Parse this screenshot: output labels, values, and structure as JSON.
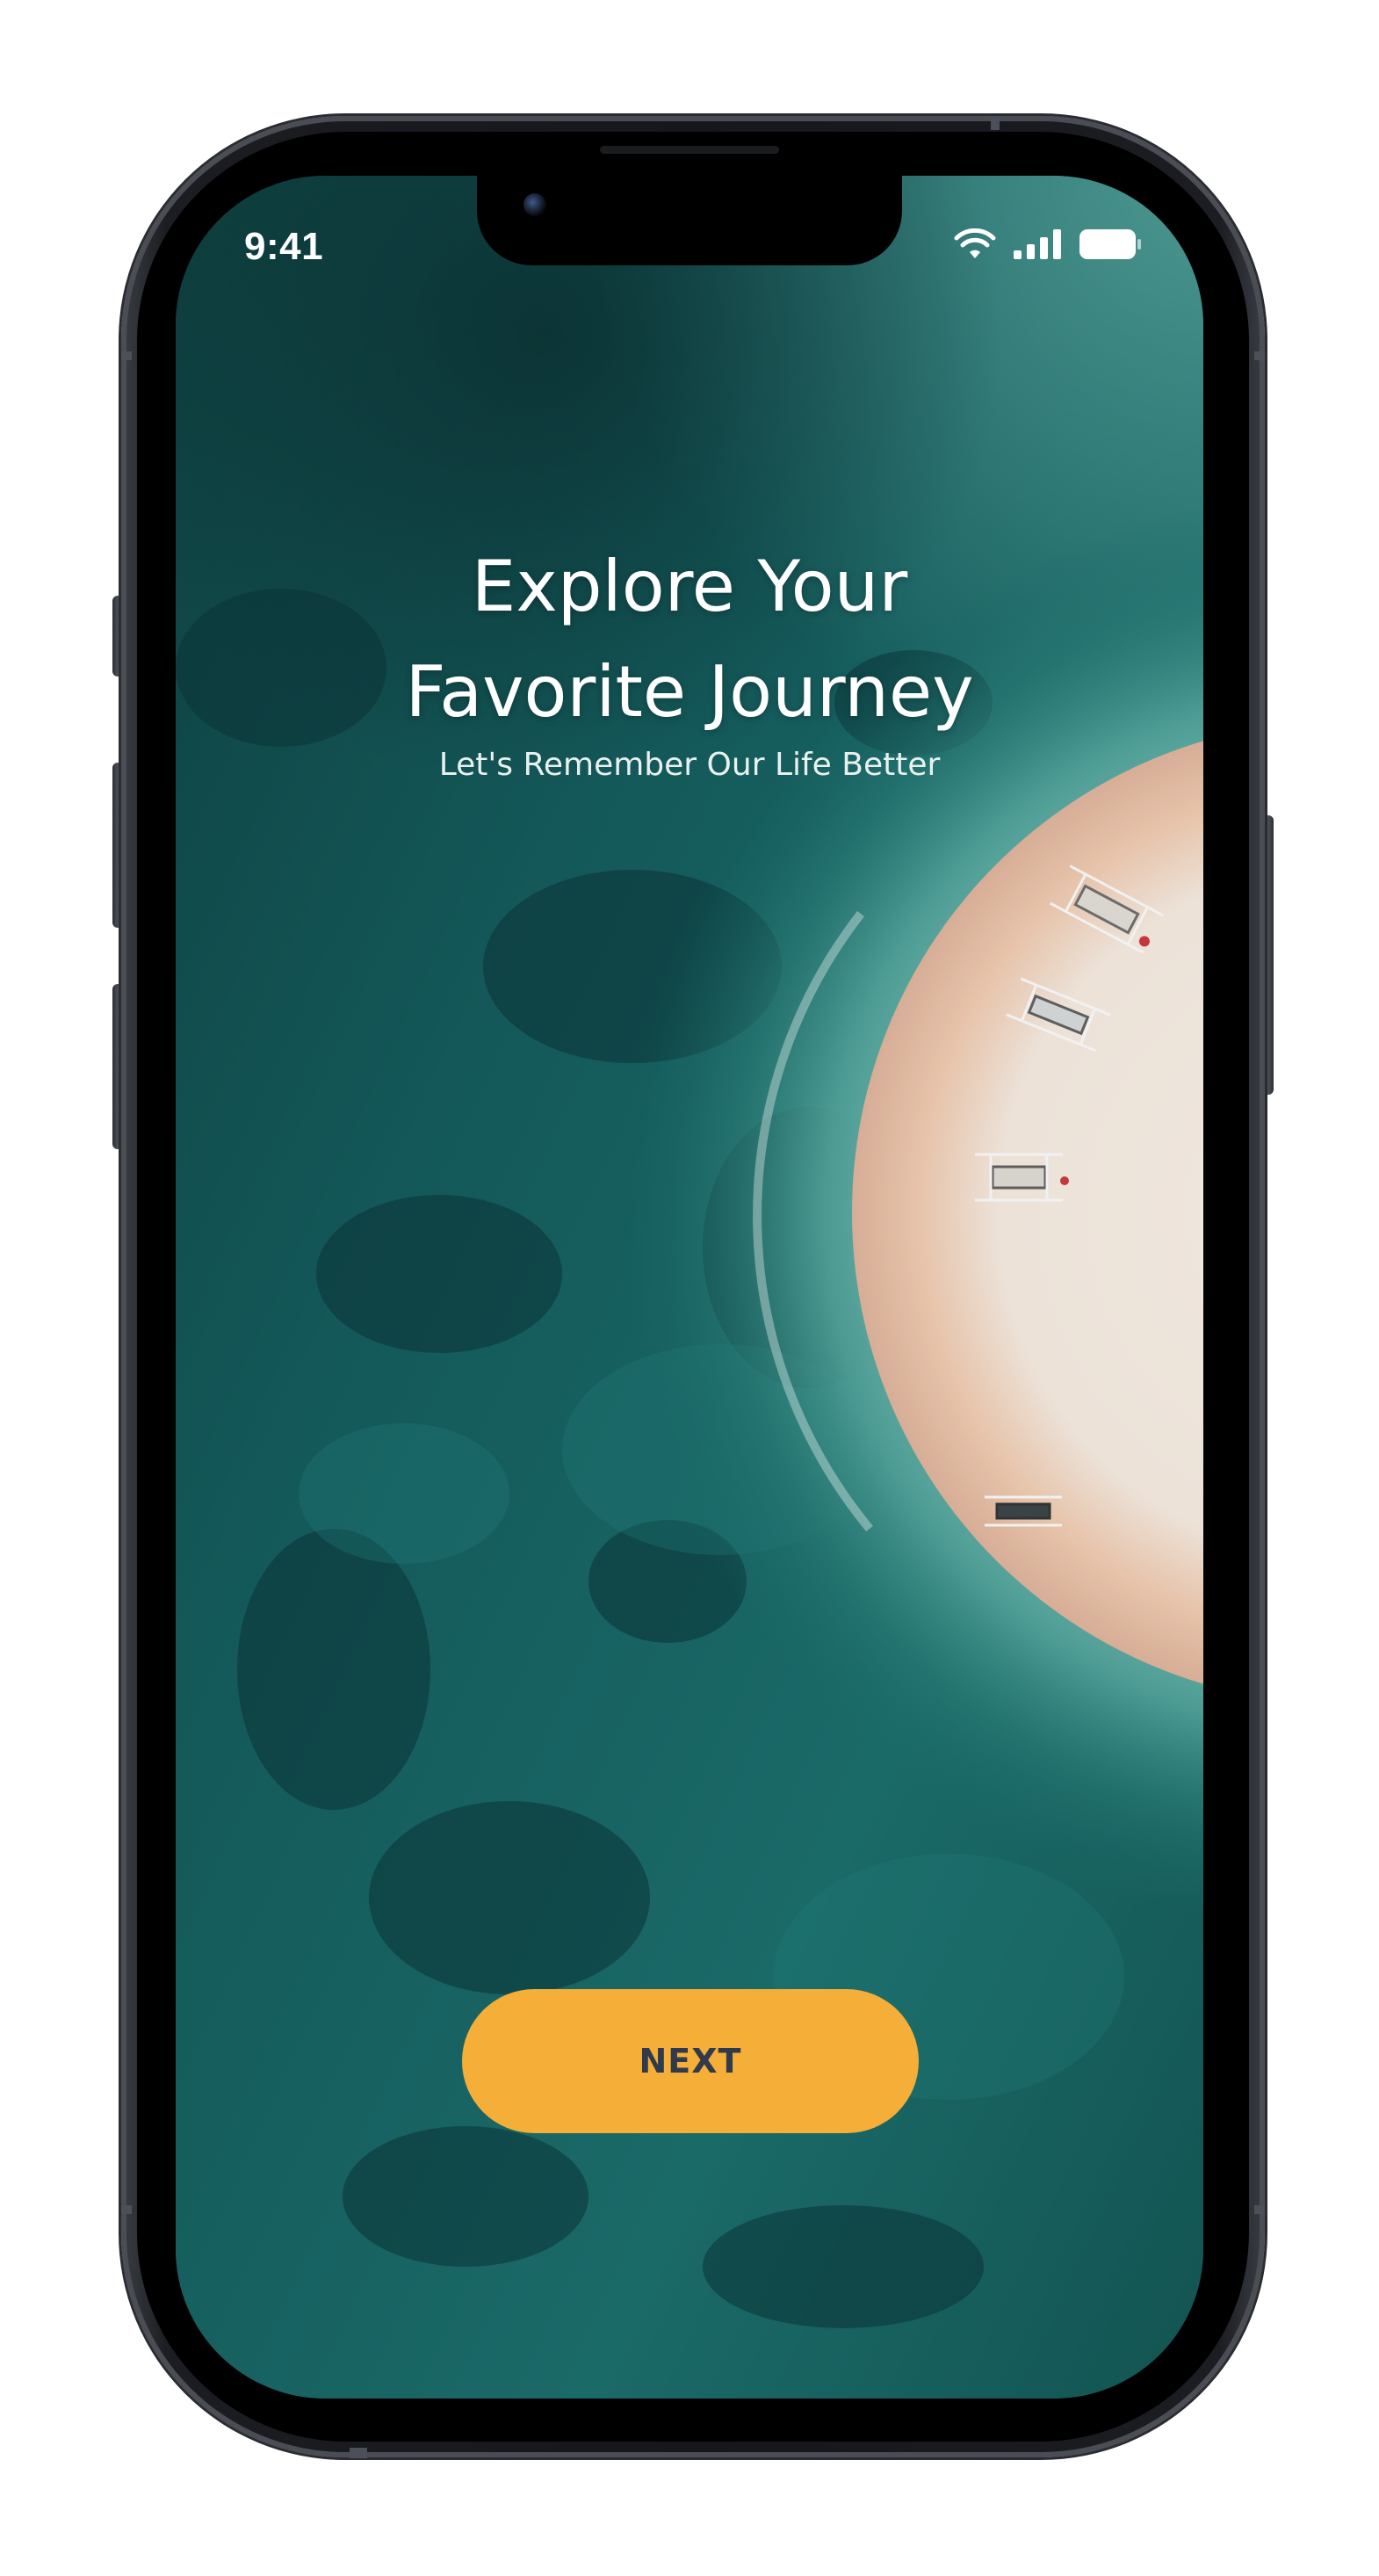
{
  "status_bar": {
    "time": "9:41",
    "icons": [
      "wifi-icon",
      "cellular-signal-icon",
      "battery-icon"
    ]
  },
  "onboarding": {
    "title_line_1": "Explore Your",
    "title_line_2": "Favorite Journey",
    "subtitle": "Let's Remember Our Life Better",
    "next_label": "NEXT"
  },
  "colors": {
    "button_background": "#f5ae38",
    "button_text": "#2f3a4c",
    "ocean": "#15595a",
    "sand": "#e9c7b0"
  }
}
